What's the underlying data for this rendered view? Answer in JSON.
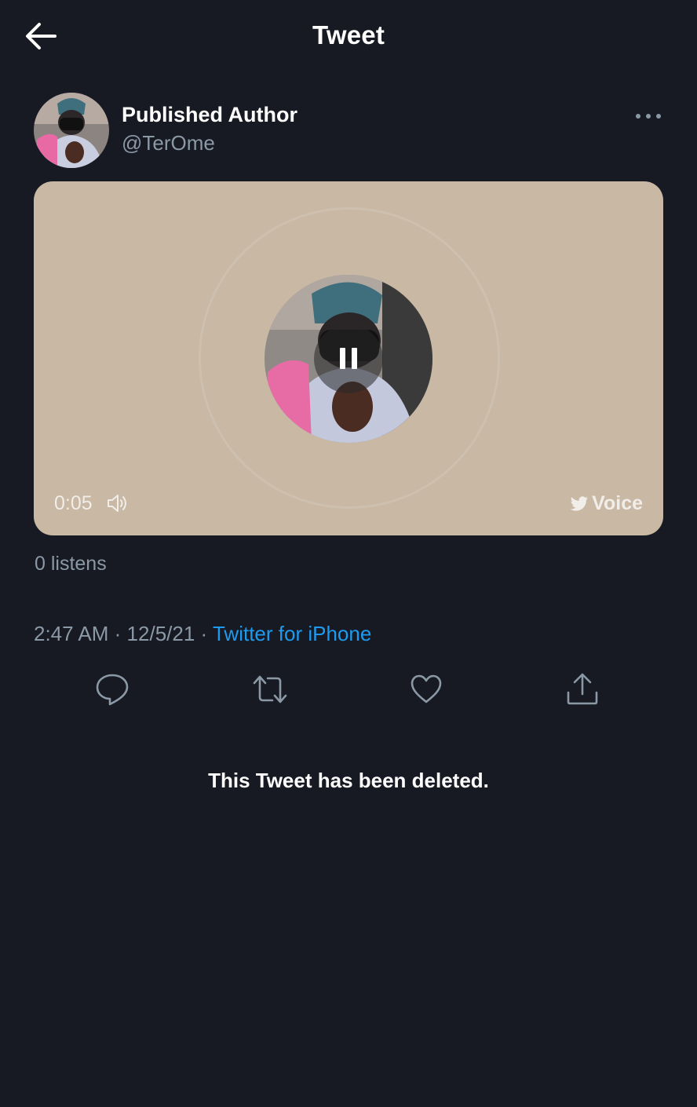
{
  "header": {
    "title": "Tweet",
    "back_icon": "arrow-left-icon"
  },
  "tweet": {
    "author_name": "Published Author",
    "author_handle": "@TerOme",
    "more_icon": "more-horizontal-icon",
    "voice": {
      "duration": "0:05",
      "brand_label": "Voice",
      "state": "playing",
      "play_icon": "pause-icon",
      "card_color": "#c8b8a4"
    },
    "listens": "0 listens",
    "time": "2:47 AM",
    "date": "12/5/21",
    "separator": "·",
    "source": "Twitter for iPhone",
    "actions": [
      {
        "icon": "reply-icon"
      },
      {
        "icon": "retweet-icon"
      },
      {
        "icon": "like-icon"
      },
      {
        "icon": "share-icon"
      }
    ]
  },
  "notice": "This Tweet has been deleted.",
  "colors": {
    "background": "#171a22",
    "secondary_text": "#8b98a5",
    "link": "#1d9bf0"
  }
}
